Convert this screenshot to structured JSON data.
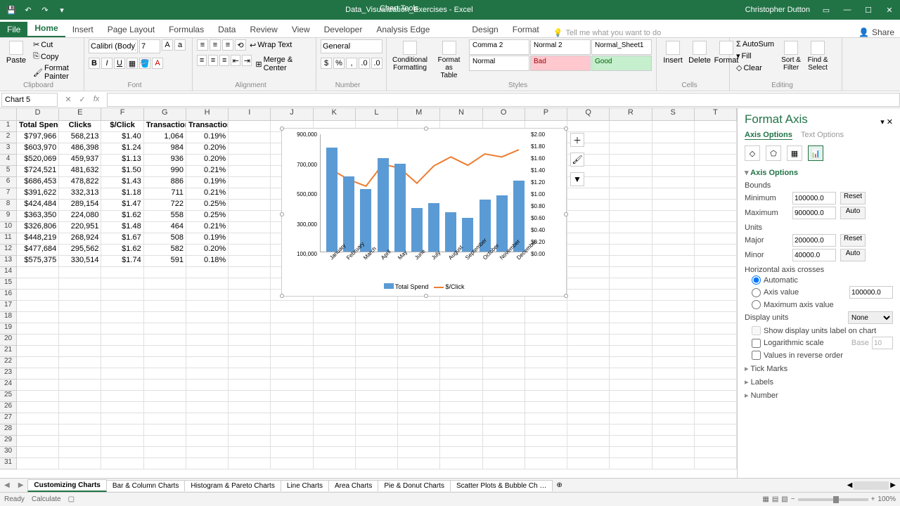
{
  "title": "Data_Visualization_Exercises - Excel",
  "chart_tools": "Chart Tools",
  "user": "Christopher Dutton",
  "tabs": {
    "file": "File",
    "home": "Home",
    "insert": "Insert",
    "pagelayout": "Page Layout",
    "formulas": "Formulas",
    "data": "Data",
    "review": "Review",
    "view": "View",
    "developer": "Developer",
    "analysisedge": "Analysis Edge",
    "design": "Design",
    "format": "Format"
  },
  "tell_me": "Tell me what you want to do",
  "share": "Share",
  "ribbon": {
    "clipboard": {
      "paste": "Paste",
      "cut": "Cut",
      "copy": "Copy",
      "painter": "Format Painter",
      "label": "Clipboard"
    },
    "font": {
      "name": "Calibri (Body)",
      "size": "7",
      "label": "Font"
    },
    "alignment": {
      "wrap": "Wrap Text",
      "merge": "Merge & Center",
      "label": "Alignment"
    },
    "number": {
      "format": "General",
      "label": "Number"
    },
    "styles": {
      "cond": "Conditional\nFormatting",
      "table": "Format as\nTable",
      "cells": [
        "Comma 2",
        "Normal 2",
        "Normal_Sheet1",
        "Normal",
        "Bad",
        "Good"
      ],
      "label": "Styles"
    },
    "cells_group": {
      "insert": "Insert",
      "delete": "Delete",
      "format": "Format",
      "label": "Cells"
    },
    "editing": {
      "autosum": "AutoSum",
      "fill": "Fill",
      "clear": "Clear",
      "sort": "Sort &\nFilter",
      "find": "Find &\nSelect",
      "label": "Editing"
    }
  },
  "namebox": "Chart 5",
  "columns": [
    "D",
    "E",
    "F",
    "G",
    "H",
    "I",
    "J",
    "K",
    "L",
    "M",
    "N",
    "O",
    "P",
    "Q",
    "R",
    "S",
    "T"
  ],
  "headers": [
    "Total Spend",
    "Clicks",
    "$/Click",
    "Transactions",
    "Transaction %"
  ],
  "rows": [
    [
      "$797,966",
      "568,213",
      "$1.40",
      "1,064",
      "0.19%"
    ],
    [
      "$603,970",
      "486,398",
      "$1.24",
      "984",
      "0.20%"
    ],
    [
      "$520,069",
      "459,937",
      "$1.13",
      "936",
      "0.20%"
    ],
    [
      "$724,521",
      "481,632",
      "$1.50",
      "990",
      "0.21%"
    ],
    [
      "$686,453",
      "478,822",
      "$1.43",
      "886",
      "0.19%"
    ],
    [
      "$391,622",
      "332,313",
      "$1.18",
      "711",
      "0.21%"
    ],
    [
      "$424,484",
      "289,154",
      "$1.47",
      "722",
      "0.25%"
    ],
    [
      "$363,350",
      "224,080",
      "$1.62",
      "558",
      "0.25%"
    ],
    [
      "$326,806",
      "220,951",
      "$1.48",
      "464",
      "0.21%"
    ],
    [
      "$448,219",
      "268,924",
      "$1.67",
      "508",
      "0.19%"
    ],
    [
      "$477,684",
      "295,562",
      "$1.62",
      "582",
      "0.20%"
    ],
    [
      "$575,375",
      "330,514",
      "$1.74",
      "591",
      "0.18%"
    ]
  ],
  "chart_data": {
    "type": "bar+line",
    "categories": [
      "January",
      "February",
      "March",
      "April",
      "May",
      "June",
      "July",
      "August",
      "September",
      "October",
      "November",
      "December"
    ],
    "series": [
      {
        "name": "Total Spend",
        "type": "bar",
        "values": [
          797966,
          603970,
          520069,
          724521,
          686453,
          391622,
          424484,
          363350,
          326806,
          448219,
          477684,
          575375
        ],
        "axis": "y1"
      },
      {
        "name": "$/Click",
        "type": "line",
        "values": [
          1.4,
          1.24,
          1.13,
          1.5,
          1.43,
          1.18,
          1.47,
          1.62,
          1.48,
          1.67,
          1.62,
          1.74
        ],
        "axis": "y2"
      }
    ],
    "y1": {
      "min": 100000,
      "max": 900000,
      "ticks": [
        "900,000",
        "700,000",
        "500,000",
        "300,000",
        "100,000"
      ]
    },
    "y2": {
      "min": 0,
      "max": 2.0,
      "ticks": [
        "$2.00",
        "$1.80",
        "$1.60",
        "$1.40",
        "$1.20",
        "$1.00",
        "$0.80",
        "$0.60",
        "$0.40",
        "$0.20",
        "$0.00"
      ]
    },
    "legend": [
      "Total Spend",
      "$/Click"
    ]
  },
  "pane": {
    "title": "Format Axis",
    "axis_options": "Axis Options",
    "text_options": "Text Options",
    "section_axis": "Axis Options",
    "bounds": "Bounds",
    "min": "Minimum",
    "min_val": "100000.0",
    "min_btn": "Reset",
    "max": "Maximum",
    "max_val": "900000.0",
    "max_btn": "Auto",
    "units": "Units",
    "major": "Major",
    "major_val": "200000.0",
    "major_btn": "Reset",
    "minor": "Minor",
    "minor_val": "40000.0",
    "minor_btn": "Auto",
    "hcrosses": "Horizontal axis crosses",
    "automatic": "Automatic",
    "axis_value": "Axis value",
    "axis_value_val": "100000.0",
    "max_axis": "Maximum axis value",
    "display_units": "Display units",
    "display_units_val": "None",
    "show_units": "Show display units label on chart",
    "log": "Logarithmic scale",
    "base": "Base",
    "base_val": "10",
    "reverse": "Values in reverse order",
    "tick": "Tick Marks",
    "labels": "Labels",
    "number": "Number"
  },
  "sheets": [
    "Customizing Charts",
    "Bar & Column Charts",
    "Histogram & Pareto Charts",
    "Line Charts",
    "Area Charts",
    "Pie & Donut Charts",
    "Scatter Plots & Bubble Ch …"
  ],
  "status": {
    "ready": "Ready",
    "calc": "Calculate",
    "zoom": "100%"
  }
}
